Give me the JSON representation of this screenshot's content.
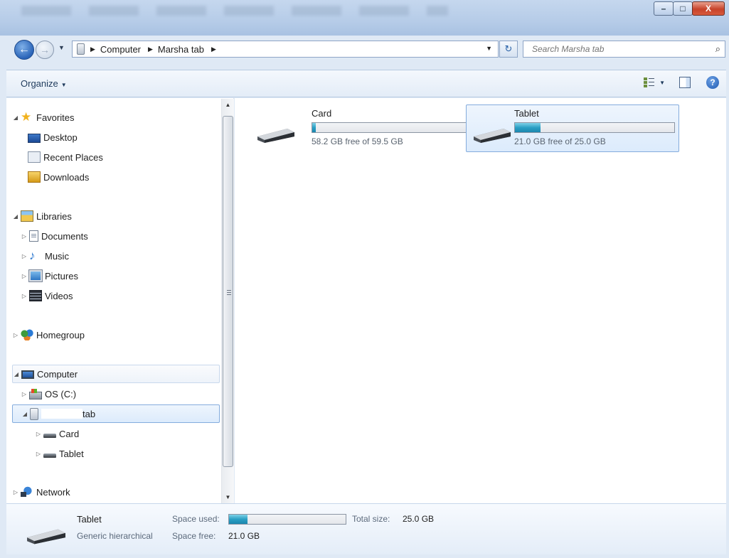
{
  "window": {
    "min_label": "–",
    "max_label": "□",
    "close_label": "X"
  },
  "address": {
    "crumbs": [
      "Computer",
      "Marsha tab"
    ],
    "search_placeholder": "Search Marsha tab"
  },
  "toolbar": {
    "organize_label": "Organize"
  },
  "nav": {
    "favorites": "Favorites",
    "desktop": "Desktop",
    "recent_places": "Recent Places",
    "downloads": "Downloads",
    "libraries": "Libraries",
    "documents": "Documents",
    "music": "Music",
    "pictures": "Pictures",
    "videos": "Videos",
    "homegroup": "Homegroup",
    "computer": "Computer",
    "os_c": "OS (C:)",
    "device_suffix": "tab",
    "card": "Card",
    "tablet": "Tablet",
    "network": "Network"
  },
  "drives": [
    {
      "name": "Card",
      "free_text": "58.2 GB free of 59.5 GB",
      "used_fraction": 0.022
    },
    {
      "name": "Tablet",
      "free_text": "21.0 GB free of 25.0 GB",
      "used_fraction": 0.16
    }
  ],
  "details": {
    "name": "Tablet",
    "type": "Generic hierarchical",
    "space_used_label": "Space used:",
    "space_used_fraction": 0.16,
    "total_size_label": "Total size:",
    "total_size_value": "25.0 GB",
    "space_free_label": "Space free:",
    "space_free_value": "21.0 GB"
  }
}
